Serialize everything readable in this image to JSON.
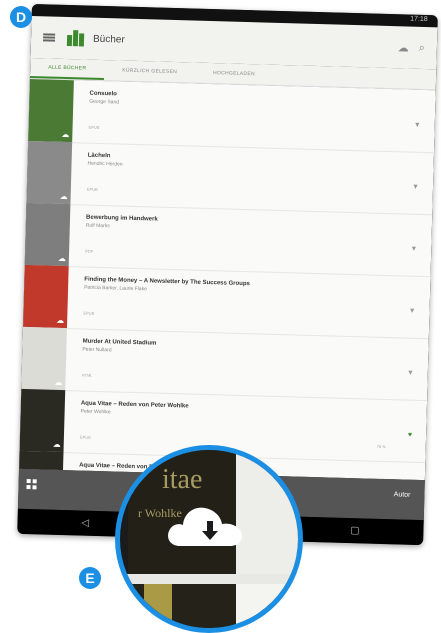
{
  "markers": {
    "top": "D",
    "bottom": "E"
  },
  "colors": {
    "accent": "#3c8a2e",
    "marker": "#1a8fe3"
  },
  "status_bar": {
    "time": "17:18"
  },
  "app_bar": {
    "menu_icon": "hamburger-icon",
    "logo_icon": "books-logo-icon",
    "title": "Bücher",
    "action_icons": [
      "cloud-icon",
      "search-icon"
    ]
  },
  "tabs": [
    {
      "label": "ALLE BÜCHER",
      "active": true
    },
    {
      "label": "KÜRZLICH GELESEN",
      "active": false
    },
    {
      "label": "HOCHGELADEN",
      "active": false
    }
  ],
  "books": [
    {
      "title": "Consuelo",
      "author": "George Sand",
      "meta": "EPUB",
      "extra": "",
      "favorite": false,
      "cover_color": "#4a7a34"
    },
    {
      "title": "Lächeln",
      "author": "Hendric Herden",
      "meta": "EPUB",
      "extra": "",
      "favorite": false,
      "cover_color": "#8a8a8a"
    },
    {
      "title": "Bewerbung im Handwerk",
      "author": "Rolf Marks",
      "meta": "PDF",
      "extra": "",
      "favorite": false,
      "cover_color": "#7e7e7e"
    },
    {
      "title": "Finding the Money – A Newsletter by The Success Groups",
      "author": "Patricia Barker, Laurie Flake",
      "meta": "EPUB",
      "extra": "",
      "favorite": false,
      "cover_color": "#c0392b"
    },
    {
      "title": "Murder At United Stadium",
      "author": "Peter Nullard",
      "meta": "HTML",
      "extra": "",
      "favorite": false,
      "cover_color": "#dcdcd6"
    },
    {
      "title": "Aqua Vitae – Reden von Peter Wohlke",
      "author": "Peter Wohlke",
      "meta": "EPUB",
      "extra": "78 %",
      "favorite": true,
      "cover_color": "#2a2a22"
    },
    {
      "title": "Aqua Vitae – Reden von Peter Wohlke",
      "author": "Peter Wohlke",
      "meta": "",
      "extra": "",
      "favorite": false,
      "cover_color": "#2a2a22"
    }
  ],
  "bottom_bar": {
    "grid_icon": "grid-icon",
    "label": "Autor"
  },
  "nav_bar": [
    "back-icon",
    "home-icon",
    "recents-icon"
  ],
  "magnifier": {
    "cover_title": "itae",
    "cover_subtitle": "r Wohlke",
    "icon": "cloud-download-icon"
  }
}
